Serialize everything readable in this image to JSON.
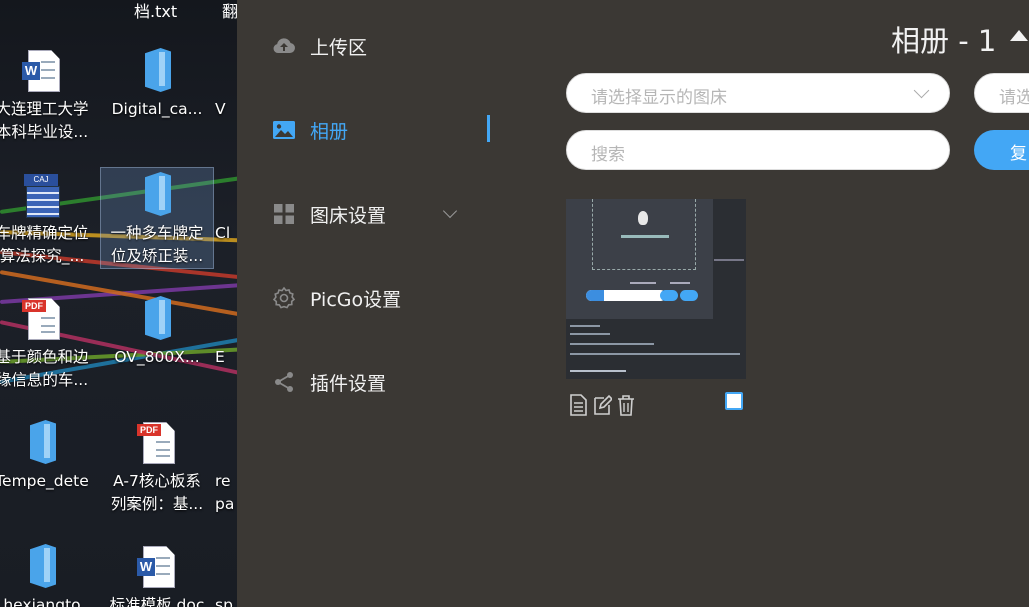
{
  "desktop": {
    "top_captions": [
      {
        "text": "档.txt"
      },
      {
        "text": "翻"
      }
    ],
    "icons": [
      {
        "line1": "大连理工大学",
        "line2": "本科毕业设..."
      },
      {
        "line1": "Digital_ca...",
        "line2": ""
      },
      {
        "line1": "V",
        "line2": ""
      },
      {
        "line1": "车牌精确定位",
        "line2": "算法探究_..."
      },
      {
        "line1": "一种多车牌定",
        "line2": "位及矫正装..."
      },
      {
        "line1": "Cl",
        "line2": ""
      },
      {
        "line1": "基于颜色和边",
        "line2": "缘信息的车..."
      },
      {
        "line1": "OV_800X...",
        "line2": ""
      },
      {
        "line1": "E",
        "line2": ""
      },
      {
        "line1": "Tempe_dete",
        "line2": ""
      },
      {
        "line1": "A-7核心板系",
        "line2": "列案例：基..."
      },
      {
        "line1": "re",
        "line2": "pa"
      },
      {
        "line1": "hexiangto",
        "line2": ""
      },
      {
        "line1": "标准模板.doc",
        "line2": ""
      },
      {
        "line1": "sp",
        "line2": ""
      }
    ]
  },
  "sidebar": {
    "items": [
      {
        "label": "上传区",
        "icon": "cloud-upload-icon"
      },
      {
        "label": "相册",
        "icon": "image-icon"
      },
      {
        "label": "图床设置",
        "icon": "grid-icon"
      },
      {
        "label": "PicGo设置",
        "icon": "gear-icon"
      },
      {
        "label": "插件设置",
        "icon": "share-icon"
      }
    ],
    "active_index": 1
  },
  "main": {
    "album_title": "相册 - 1",
    "picbed_select": {
      "placeholder": "请选择显示的图床"
    },
    "second_select": {
      "placeholder": "请选"
    },
    "search": {
      "placeholder": "搜索"
    },
    "action_button": {
      "label": "复"
    }
  },
  "colors": {
    "accent": "#43a7f5",
    "panel": "#3b3834"
  }
}
